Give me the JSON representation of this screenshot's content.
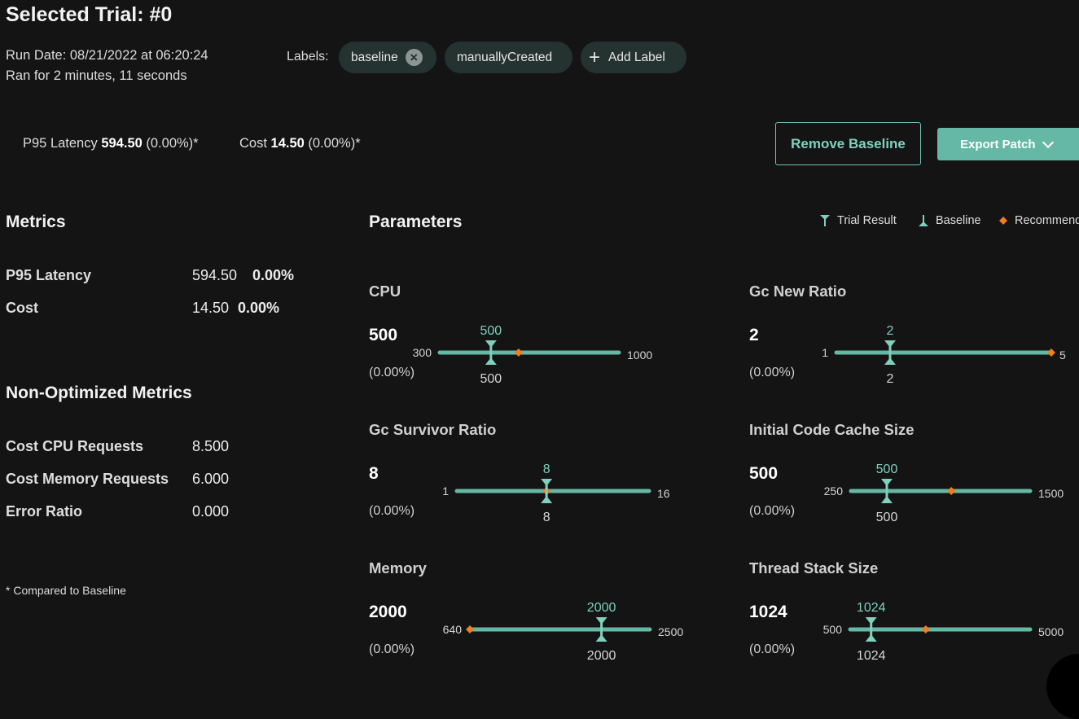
{
  "header": {
    "title": "Selected Trial: #0",
    "run_date": "Run Date: 08/21/2022 at 06:20:24",
    "duration": "Ran for 2 minutes, 11 seconds",
    "labels_caption": "Labels:",
    "labels": [
      "baseline",
      "manuallyCreated"
    ],
    "add_label": "Add Label"
  },
  "summary": {
    "latency_label": "P95 Latency",
    "latency_value": "594.50",
    "latency_delta": "(0.00%)*",
    "cost_label": "Cost",
    "cost_value": "14.50",
    "cost_delta": "(0.00%)*"
  },
  "actions": {
    "remove_baseline": "Remove Baseline",
    "export_patch": "Export Patch"
  },
  "metrics": {
    "title": "Metrics",
    "rows": [
      {
        "name": "P95 Latency",
        "value": "594.50",
        "delta": "0.00%"
      },
      {
        "name": "Cost",
        "value": "14.50",
        "delta": "0.00%"
      }
    ]
  },
  "non_optimized": {
    "title": "Non-Optimized Metrics",
    "rows": [
      {
        "name": "Cost CPU Requests",
        "value": "8.500"
      },
      {
        "name": "Cost Memory Requests",
        "value": "6.000"
      },
      {
        "name": "Error Ratio",
        "value": "0.000"
      }
    ]
  },
  "footnote": "* Compared to Baseline",
  "parameters": {
    "title": "Parameters",
    "legend": {
      "trial": "Trial Result",
      "baseline": "Baseline",
      "recommended": "Recommend"
    },
    "colors": {
      "trial": "#7fd0be",
      "track": "#65b8a5",
      "recommended": "#f07d1e"
    },
    "items": [
      {
        "name": "CPU",
        "value": "500",
        "pct": "(0.00%)",
        "min": "300",
        "max": "1000",
        "trial": "500",
        "baseline": "500",
        "trial_frac": 0.2857,
        "rec_frac": 0.44
      },
      {
        "name": "Gc New Ratio",
        "value": "2",
        "pct": "(0.00%)",
        "min": "1",
        "max": "5",
        "trial": "2",
        "baseline": "2",
        "trial_frac": 0.25,
        "rec_frac": 1.0
      },
      {
        "name": "Gc Survivor Ratio",
        "value": "8",
        "pct": "(0.00%)",
        "min": "1",
        "max": "16",
        "trial": "8",
        "baseline": "8",
        "trial_frac": 0.4667,
        "rec_frac": 0.4667
      },
      {
        "name": "Initial Code Cache Size",
        "value": "500",
        "pct": "(0.00%)",
        "min": "250",
        "max": "1500",
        "trial": "500",
        "baseline": "500",
        "trial_frac": 0.2,
        "rec_frac": 0.56
      },
      {
        "name": "Memory",
        "value": "2000",
        "pct": "(0.00%)",
        "min": "640",
        "max": "2500",
        "trial": "2000",
        "baseline": "2000",
        "trial_frac": 0.7312,
        "rec_frac": 0.0
      },
      {
        "name": "Thread Stack Size",
        "value": "1024",
        "pct": "(0.00%)",
        "min": "500",
        "max": "5000",
        "trial": "1024",
        "baseline": "1024",
        "trial_frac": 0.1164,
        "rec_frac": 0.42
      }
    ]
  }
}
